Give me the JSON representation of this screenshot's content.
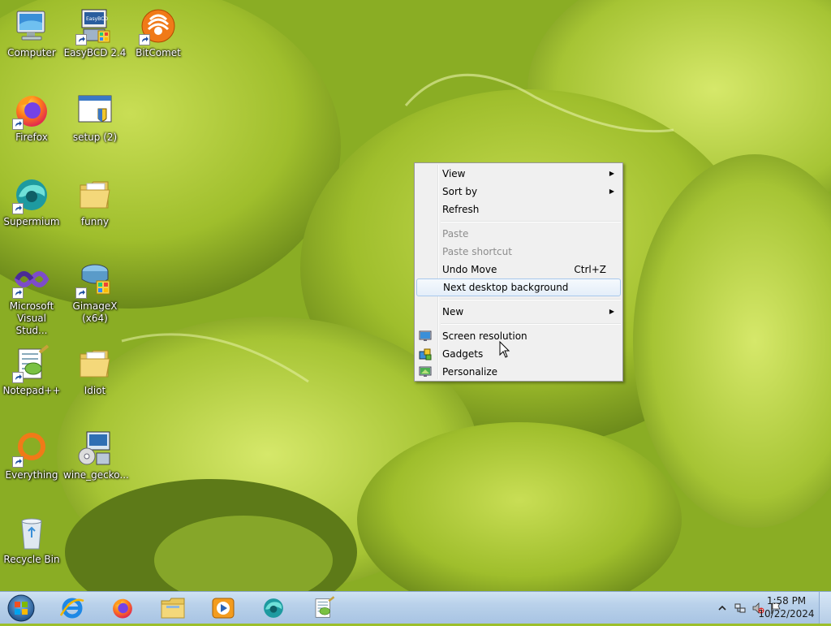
{
  "desktop": {
    "icons": [
      {
        "label": "Computer",
        "icon": "computer-icon",
        "shortcut": false
      },
      {
        "label": "EasyBCD 2.4",
        "icon": "easybcd-icon",
        "shortcut": true
      },
      {
        "label": "BitComet",
        "icon": "bitcomet-icon",
        "shortcut": true
      },
      {
        "label": "Firefox",
        "icon": "firefox-icon",
        "shortcut": true
      },
      {
        "label": "setup (2)",
        "icon": "setup-installer-icon",
        "shortcut": false
      },
      {
        "label": "Supermium",
        "icon": "supermium-icon",
        "shortcut": true
      },
      {
        "label": "funny",
        "icon": "folder-icon",
        "shortcut": false
      },
      {
        "label": "Microsoft\nVisual Stud...",
        "icon": "visual-studio-icon",
        "shortcut": true
      },
      {
        "label": "GimageX\n(x64)",
        "icon": "gimagex-icon",
        "shortcut": true
      },
      {
        "label": "Notepad++",
        "icon": "notepadpp-icon",
        "shortcut": true
      },
      {
        "label": "Idiot",
        "icon": "folder-icon",
        "shortcut": false
      },
      {
        "label": "Everything",
        "icon": "everything-icon",
        "shortcut": true
      },
      {
        "label": "wine_gecko...",
        "icon": "installer-package-icon",
        "shortcut": false
      },
      {
        "label": "Recycle Bin",
        "icon": "recycle-bin-icon",
        "shortcut": false
      }
    ]
  },
  "context_menu": {
    "items": [
      {
        "label": "View",
        "submenu": true
      },
      {
        "label": "Sort by",
        "submenu": true
      },
      {
        "label": "Refresh"
      },
      {
        "label": "Paste",
        "disabled": true
      },
      {
        "label": "Paste shortcut",
        "disabled": true
      },
      {
        "label": "Undo Move",
        "shortcut": "Ctrl+Z"
      },
      {
        "label": "Next desktop background",
        "highlighted": true
      },
      {
        "label": "New",
        "submenu": true
      },
      {
        "label": "Screen resolution",
        "icon": "screen-resolution-icon"
      },
      {
        "label": "Gadgets",
        "icon": "gadgets-icon"
      },
      {
        "label": "Personalize",
        "icon": "personalize-icon"
      }
    ]
  },
  "taskbar": {
    "start_icon": "windows-orb-icon",
    "pinned": [
      {
        "name": "Internet Explorer",
        "icon": "internet-explorer-icon"
      },
      {
        "name": "Firefox",
        "icon": "firefox-icon"
      },
      {
        "name": "Windows Explorer",
        "icon": "file-explorer-icon"
      },
      {
        "name": "Windows Media Player",
        "icon": "media-player-icon"
      },
      {
        "name": "Supermium",
        "icon": "supermium-icon"
      },
      {
        "name": "Notepad++",
        "icon": "notepadpp-icon"
      }
    ],
    "tray": {
      "icons": [
        "show-hidden-icons-chevron-icon",
        "network-icon",
        "volume-muted-icon",
        "action-center-flag-icon"
      ],
      "time": "1:58 PM",
      "date": "10/22/2024"
    }
  },
  "colors": {
    "wallpaper_primary": "#9cbf2a",
    "menu_background": "#f0f0f0",
    "menu_highlight_border": "#a8c8ec",
    "taskbar": "#b9d1ea"
  }
}
